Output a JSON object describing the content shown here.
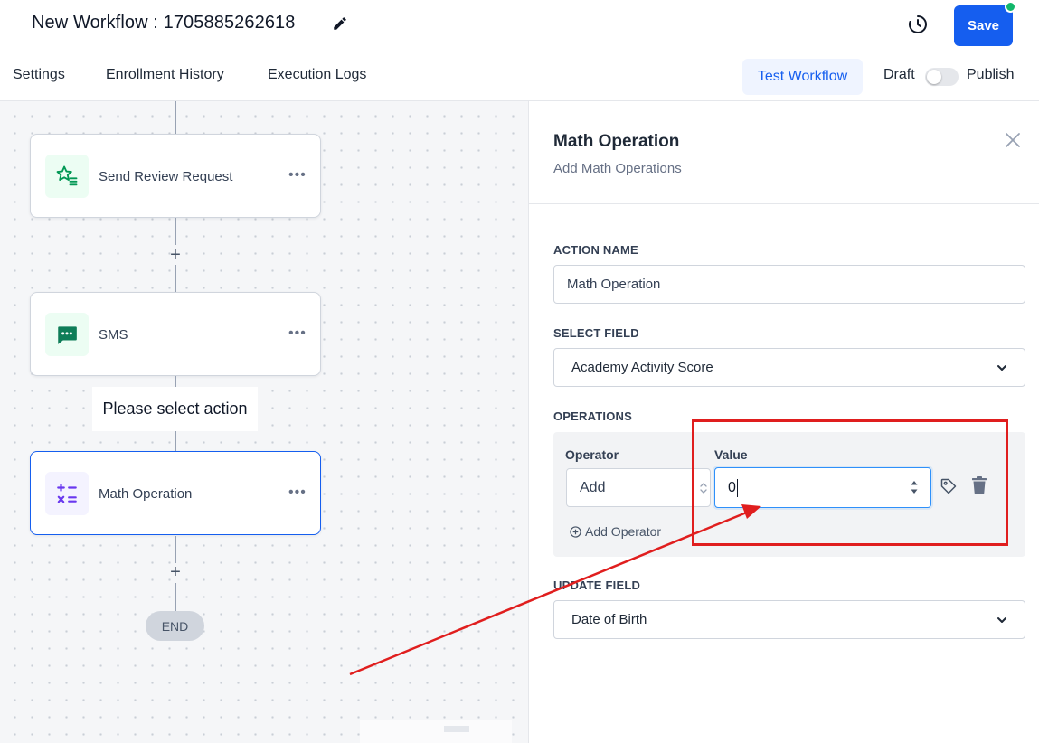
{
  "header": {
    "title": "New Workflow : 1705885262618",
    "save_label": "Save"
  },
  "tabs": {
    "settings": "Settings",
    "enrollment_history": "Enrollment History",
    "execution_logs": "Execution Logs",
    "test_workflow": "Test Workflow",
    "draft": "Draft",
    "publish": "Publish",
    "publish_enabled": false
  },
  "canvas": {
    "nodes": [
      {
        "label": "Send Review Request",
        "icon": "star-list-icon",
        "color": "#12b76a"
      },
      {
        "label": "SMS",
        "icon": "sms-bubble-icon",
        "color": "#0e9384"
      },
      {
        "label": "Math Operation",
        "icon": "math-operators-icon",
        "color": "#7a5af8"
      }
    ],
    "tooltip": "Please select action",
    "end_label": "END"
  },
  "panel": {
    "title": "Math Operation",
    "subtitle": "Add Math Operations",
    "action_name_label": "ACTION NAME",
    "action_name_value": "Math Operation",
    "select_field_label": "SELECT FIELD",
    "select_field_value": "Academy Activity Score",
    "operations_label": "OPERATIONS",
    "operator_label": "Operator",
    "operator_value": "Add",
    "value_label": "Value",
    "value_value": "0",
    "add_operator_label": "Add Operator",
    "update_field_label": "UPDATE FIELD",
    "update_field_value": "Date of Birth"
  },
  "colors": {
    "accent": "#155eef",
    "annotation": "#e01e1e"
  }
}
